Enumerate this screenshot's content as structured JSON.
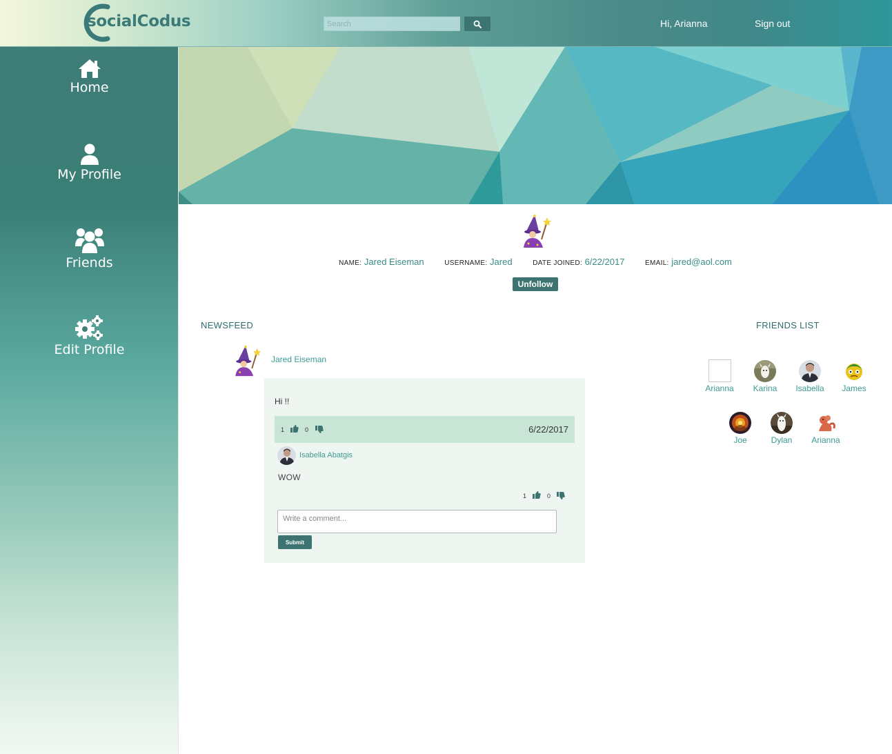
{
  "header": {
    "logo_text": "socialCodus",
    "search_placeholder": "Search",
    "greeting": "Hi, Arianna",
    "signout_label": "Sign out"
  },
  "sidebar": {
    "items": [
      {
        "label": "Home",
        "icon": "home-icon"
      },
      {
        "label": "My Profile",
        "icon": "user-icon"
      },
      {
        "label": "Friends",
        "icon": "users-icon"
      },
      {
        "label": "Edit Profile",
        "icon": "gears-icon"
      }
    ]
  },
  "profile": {
    "name_label": "Name:",
    "name": "Jared Eiseman",
    "username_label": "Username:",
    "username": "Jared",
    "date_label": "Date Joined:",
    "date_joined": "6/22/2017",
    "email_label": "Email:",
    "email": "jared@aol.com",
    "unfollow_label": "Unfollow"
  },
  "newsfeed": {
    "title": "NEWSFEED",
    "post": {
      "author": "Jared Eiseman",
      "text": "Hi !!",
      "likes": "1",
      "dislikes": "0",
      "date": "6/22/2017",
      "comment": {
        "author": "Isabella Abatgis",
        "text": "WOW",
        "likes": "1",
        "dislikes": "0"
      },
      "comment_placeholder": "Write a comment...",
      "submit_label": "Submit"
    }
  },
  "friends": {
    "title": "FRIENDS LIST",
    "list": [
      "Arianna",
      "Karina",
      "Isabella",
      "James",
      "Joe",
      "Dylan",
      "Arianna"
    ]
  },
  "colors": {
    "accent": "#3d7472",
    "link": "#3d9a94"
  }
}
